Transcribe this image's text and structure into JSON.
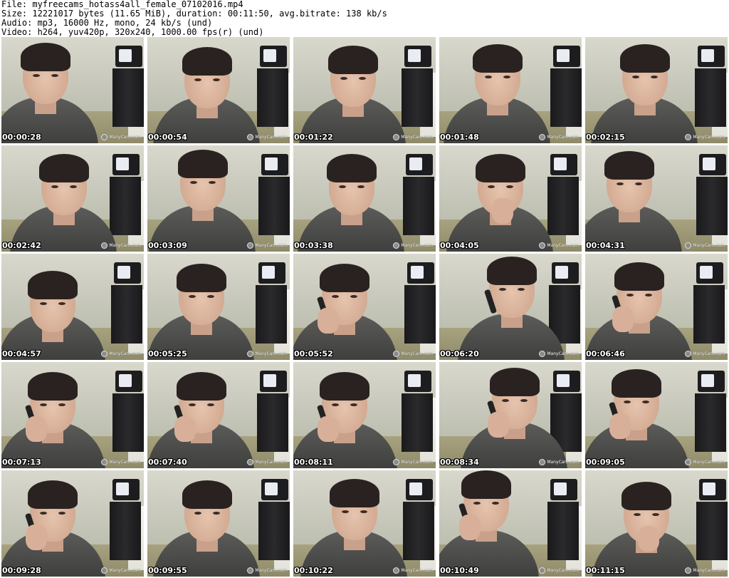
{
  "header": {
    "file_line": "File: myfreecams_hotass4all_female_07102016.mp4",
    "size_line": "Size: 12221017 bytes (11.65 MiB), duration: 00:11:50, avg.bitrate: 138 kb/s",
    "audio_line": "Audio: mp3, 16000 Hz, mono, 24 kb/s (und)",
    "video_line": "Video: h264, yuv420p, 320x240, 1000.00 fps(r) (und)"
  },
  "watermark": "ManyCam.com",
  "thumbnails": [
    {
      "time": "00:00:28",
      "phone": false,
      "hand": false
    },
    {
      "time": "00:00:54",
      "phone": false,
      "hand": false
    },
    {
      "time": "00:01:22",
      "phone": false,
      "hand": false
    },
    {
      "time": "00:01:48",
      "phone": false,
      "hand": false
    },
    {
      "time": "00:02:15",
      "phone": false,
      "hand": false
    },
    {
      "time": "00:02:42",
      "phone": false,
      "hand": false
    },
    {
      "time": "00:03:09",
      "phone": false,
      "hand": false
    },
    {
      "time": "00:03:38",
      "phone": false,
      "hand": false
    },
    {
      "time": "00:04:05",
      "phone": false,
      "hand": true
    },
    {
      "time": "00:04:31",
      "phone": false,
      "hand": false
    },
    {
      "time": "00:04:57",
      "phone": false,
      "hand": false
    },
    {
      "time": "00:05:25",
      "phone": false,
      "hand": false
    },
    {
      "time": "00:05:52",
      "phone": true,
      "hand": true
    },
    {
      "time": "00:06:20",
      "phone": true,
      "hand": false
    },
    {
      "time": "00:06:46",
      "phone": true,
      "hand": true
    },
    {
      "time": "00:07:13",
      "phone": true,
      "hand": true
    },
    {
      "time": "00:07:40",
      "phone": true,
      "hand": true
    },
    {
      "time": "00:08:11",
      "phone": true,
      "hand": true
    },
    {
      "time": "00:08:34",
      "phone": true,
      "hand": true
    },
    {
      "time": "00:09:05",
      "phone": true,
      "hand": true
    },
    {
      "time": "00:09:28",
      "phone": true,
      "hand": true
    },
    {
      "time": "00:09:55",
      "phone": false,
      "hand": false
    },
    {
      "time": "00:10:22",
      "phone": false,
      "hand": false
    },
    {
      "time": "00:10:49",
      "phone": true,
      "hand": true
    },
    {
      "time": "00:11:15",
      "phone": false,
      "hand": true
    }
  ]
}
